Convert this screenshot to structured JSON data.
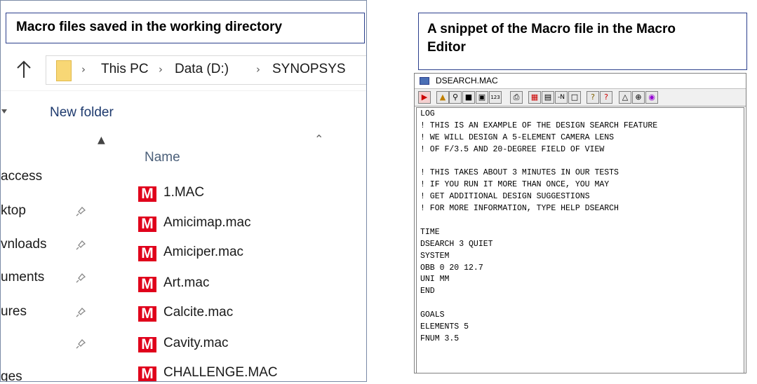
{
  "left_panel": {
    "caption": "Macro files saved in the working directory",
    "address": {
      "up_icon": "up-arrow-icon",
      "breadcrumbs": [
        "This PC",
        "Data (D:)",
        "SYNOPSYS"
      ]
    },
    "toolbar": {
      "new_folder_label": "New folder"
    },
    "sidebar": {
      "items": [
        {
          "label": "access",
          "pinned": false
        },
        {
          "label": "ktop",
          "pinned": true
        },
        {
          "label": "vnloads",
          "pinned": true
        },
        {
          "label": "uments",
          "pinned": true
        },
        {
          "label": "ures",
          "pinned": true
        },
        {
          "label": "",
          "pinned": true
        },
        {
          "label": "ges",
          "pinned": false
        }
      ]
    },
    "file_list": {
      "column_header": "Name",
      "files": [
        "1.MAC",
        "Amicimap.mac",
        "Amiciper.mac",
        "Art.mac",
        "Calcite.mac",
        "Cavity.mac",
        "CHALLENGE.MAC"
      ],
      "icon_letter": "M",
      "icon_color": "#e0001b"
    }
  },
  "right_panel": {
    "caption_line1": "A snippet of the Macro file in the Macro",
    "caption_line2": "Editor",
    "editor": {
      "title": "DSEARCH.MAC",
      "toolbar_icons": [
        "exit-icon",
        "open-icon",
        "find-icon",
        "save-icon",
        "save-as-icon",
        "numbers-icon",
        "print-icon",
        "macro-icon",
        "page-icon",
        "minus-n-icon",
        "box-icon",
        "help-icon",
        "help-context-icon",
        "triangle-icon",
        "target-icon",
        "lens-icon"
      ],
      "lines": [
        "LOG",
        "! THIS IS AN EXAMPLE OF THE DESIGN SEARCH FEATURE",
        "! WE WILL DESIGN A 5-ELEMENT CAMERA LENS",
        "! OF F/3.5 AND 20-DEGREE FIELD OF VIEW",
        "",
        "! THIS TAKES ABOUT 3 MINUTES IN OUR TESTS",
        "! IF YOU RUN IT MORE THAN ONCE, YOU MAY",
        "! GET ADDITIONAL DESIGN SUGGESTIONS",
        "! FOR MORE INFORMATION, TYPE HELP DSEARCH",
        "",
        "TIME",
        "DSEARCH 3 QUIET",
        "SYSTEM",
        "OBB 0 20 12.7",
        "UNI MM",
        "END",
        "",
        "GOALS",
        "ELEMENTS 5",
        "FNUM 3.5"
      ]
    }
  }
}
